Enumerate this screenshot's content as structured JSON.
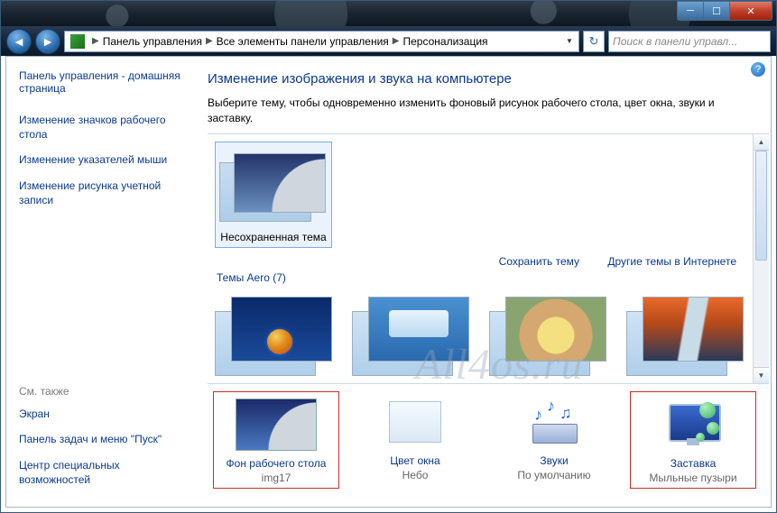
{
  "window": {
    "breadcrumb": [
      "Панель управления",
      "Все элементы панели управления",
      "Персонализация"
    ],
    "search_placeholder": "Поиск в панели управл..."
  },
  "sidebar": {
    "home": "Панель управления - домашняя страница",
    "links": [
      "Изменение значков рабочего стола",
      "Изменение указателей мыши",
      "Изменение рисунка учетной записи"
    ],
    "see_also_header": "См. также",
    "see_also": [
      "Экран",
      "Панель задач и меню \"Пуск\"",
      "Центр специальных возможностей"
    ]
  },
  "main": {
    "title": "Изменение изображения и звука на компьютере",
    "description": "Выберите тему, чтобы одновременно изменить фоновый рисунок рабочего стола, цвет окна, звуки и заставку.",
    "unsaved_theme": "Несохраненная тема",
    "save_link": "Сохранить тему",
    "online_link": "Другие темы в Интернете",
    "aero_header": "Темы Aero (7)",
    "options": [
      {
        "label": "Фон рабочего стола",
        "value": "img17"
      },
      {
        "label": "Цвет окна",
        "value": "Небо"
      },
      {
        "label": "Звуки",
        "value": "По умолчанию"
      },
      {
        "label": "Заставка",
        "value": "Мыльные пузыри"
      }
    ]
  },
  "watermark": "All4os.ru"
}
